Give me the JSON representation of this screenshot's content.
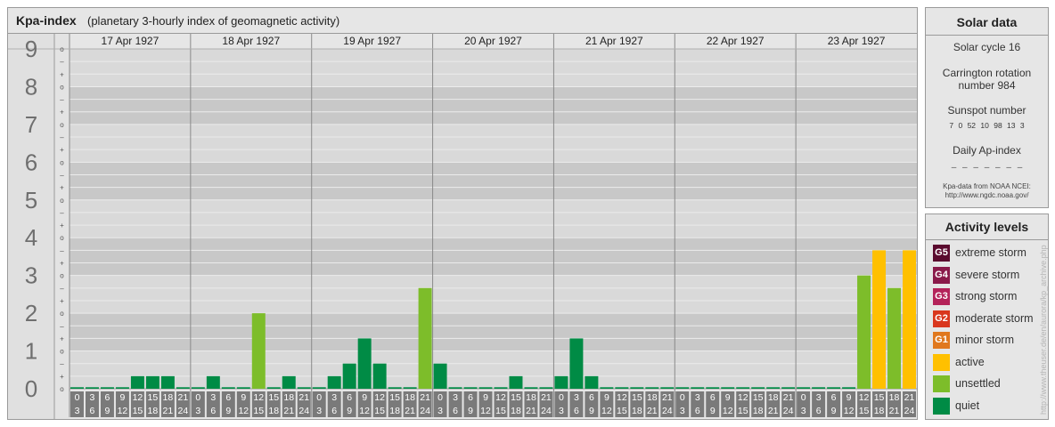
{
  "header": {
    "title": "Kpa-index",
    "subtitle": "(planetary 3-hourly index of geomagnetic activity)"
  },
  "solar": {
    "title": "Solar data",
    "cycle": "Solar cycle 16",
    "carrington_line1": "Carrington rotation",
    "carrington_line2": "number 984",
    "sunspot_title": "Sunspot number",
    "sunspot_values": "7 0 52 10 98 13 3",
    "ap_title": "Daily Ap-index",
    "ap_values": "– – – – – – –",
    "source_line1": "Kpa-data from NOAA NCEI:",
    "source_line2": "http://www.ngdc.noaa.gov/"
  },
  "activity": {
    "title": "Activity levels",
    "levels": [
      {
        "badge": "G5",
        "label": "extreme storm",
        "color": "#5a0a2e"
      },
      {
        "badge": "G4",
        "label": "severe storm",
        "color": "#8a1a4a"
      },
      {
        "badge": "G3",
        "label": "strong storm",
        "color": "#b4235a"
      },
      {
        "badge": "G2",
        "label": "moderate storm",
        "color": "#d9361d"
      },
      {
        "badge": "G1",
        "label": "minor storm",
        "color": "#e0781e"
      },
      {
        "badge": "",
        "label": "active",
        "color": "#ffc000"
      },
      {
        "badge": "",
        "label": "unsettled",
        "color": "#7dbd2a"
      },
      {
        "badge": "",
        "label": "quiet",
        "color": "#008b45"
      }
    ]
  },
  "credit": "http://www.theuser.de/en/aurora/kp_archive.php",
  "chart_data": {
    "type": "bar",
    "title": "Kpa-index",
    "ylim": [
      0,
      9
    ],
    "y_major_ticks": [
      "0",
      "1",
      "2",
      "3",
      "4",
      "5",
      "6",
      "7",
      "8",
      "9"
    ],
    "y_minor_labels": [
      "o",
      "+",
      "–"
    ],
    "days": [
      "17 Apr 1927",
      "18 Apr 1927",
      "19 Apr 1927",
      "20 Apr 1927",
      "21 Apr 1927",
      "22 Apr 1927",
      "23 Apr 1927"
    ],
    "interval_start_labels": [
      "0",
      "3",
      "6",
      "9",
      "12",
      "15",
      "18",
      "21"
    ],
    "interval_end_labels": [
      "3",
      "6",
      "9",
      "12",
      "15",
      "18",
      "21",
      "24"
    ],
    "values": [
      0,
      0,
      0,
      0,
      0.333,
      0.333,
      0.333,
      0,
      0,
      0.333,
      0,
      0,
      2,
      0,
      0.333,
      0,
      0,
      0.333,
      0.667,
      1.333,
      0.667,
      0,
      0,
      2.667,
      0.667,
      0,
      0,
      0,
      0,
      0.333,
      0,
      0,
      0.333,
      1.333,
      0.333,
      0,
      0,
      0,
      0,
      0,
      0,
      0,
      0,
      0,
      0,
      0,
      0,
      0,
      0,
      0,
      0,
      0,
      3,
      3.667,
      2.667,
      3.667
    ],
    "colors": {
      "quiet": "#008b45",
      "unsettled": "#7dbd2a",
      "active": "#ffc000"
    },
    "grid": true
  }
}
